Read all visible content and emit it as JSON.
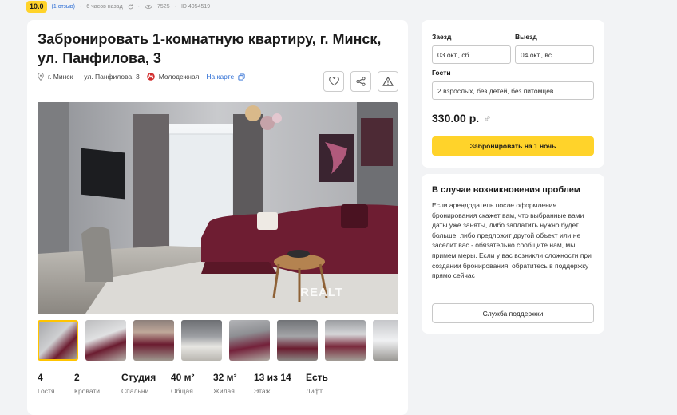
{
  "meta": {
    "rating": "10.0",
    "reviews": "(1 отзыв)",
    "posted": "6 часов назад",
    "views": "7525",
    "listing_id": "ID 4054519"
  },
  "listing": {
    "title": "Забронировать 1-комнатную квартиру, г. Минск, ул. Панфилова, 3",
    "city": "г. Минск",
    "street": "ул. Панфилова, 3",
    "metro": "Молодежная",
    "map_link": "На карте"
  },
  "photo": {
    "watermark": "REALT"
  },
  "stats": [
    {
      "value": "4",
      "label": "Гостя"
    },
    {
      "value": "2",
      "label": "Кровати"
    },
    {
      "value": "Студия",
      "label": "Спальни"
    },
    {
      "value": "40 м²",
      "label": "Общая"
    },
    {
      "value": "32 м²",
      "label": "Жилая"
    },
    {
      "value": "13 из 14",
      "label": "Этаж"
    },
    {
      "value": "Есть",
      "label": "Лифт"
    }
  ],
  "booking": {
    "checkin_label": "Заезд",
    "checkin_value": "03 окт., сб",
    "checkout_label": "Выезд",
    "checkout_value": "04 окт., вс",
    "guests_label": "Гости",
    "guests_value": "2 взрослых, без детей, без питомцев",
    "price": "330.00 р.",
    "book_button": "Забронировать на 1 ночь"
  },
  "help": {
    "title": "В случае возникновения проблем",
    "text": "Если арендодатель после оформления бронирования скажет вам, что выбранные вами даты уже заняты, либо заплатить нужно будет больше, либо предложит другой объект или не заселит вас - обязательно сообщите нам, мы примем меры. Если у вас возникли сложности при создании бронирования, обратитесь в поддержку прямо сейчас",
    "support_button": "Служба поддержки"
  },
  "colors": {
    "accent": "#ffd32a",
    "link": "#2b6cd4",
    "metro": "#d12b2b"
  }
}
